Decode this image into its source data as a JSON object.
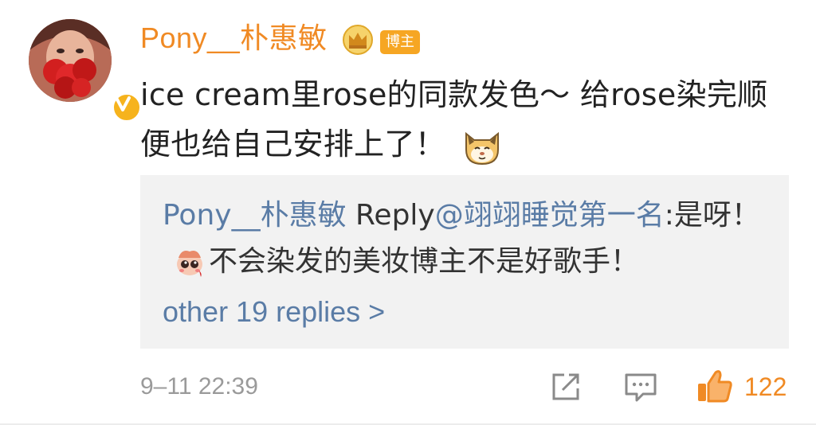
{
  "user": {
    "name": "Pony__朴惠敏",
    "badge_label": "博主",
    "verified_badge": "V"
  },
  "comment": {
    "text": "ice cream里rose的同款发色～ 给rose染完顺便也给自己安排上了！",
    "emoji_icon": "cat-face-emoji"
  },
  "reply": {
    "author": "Pony__朴惠敏",
    "action": " Reply",
    "mention": "@翊翊睡觉第一名",
    "text_before_emoji": ":是呀！",
    "emoji_icon": "cute-crying-emoji",
    "text_after_emoji": "不会染发的美妆博主不是好歌手！",
    "more_link": "other 19 replies >"
  },
  "footer": {
    "timestamp": "9–11 22:39",
    "like_count": "122"
  },
  "colors": {
    "accent_orange": "#f08a24",
    "link_blue": "#5a7ca6",
    "badge_gold": "#f6a623"
  }
}
